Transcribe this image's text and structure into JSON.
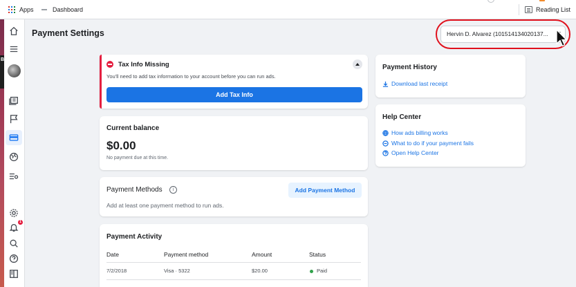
{
  "browser": {
    "bookmarks": {
      "apps": "Apps",
      "dashboard": "Dashboard",
      "reading_list": "Reading List"
    }
  },
  "strip_label": "B",
  "page": {
    "title": "Payment Settings"
  },
  "account_selector": {
    "value": "Hervin D. Alvarez (101514134020137..."
  },
  "tax_card": {
    "title": "Tax Info Missing",
    "description": "You'll need to add tax information to your account before you can run ads.",
    "button": "Add Tax Info"
  },
  "balance_card": {
    "label": "Current balance",
    "amount": "$0.00",
    "note": "No payment due at this time."
  },
  "payment_methods": {
    "title": "Payment Methods",
    "info": "i",
    "description": "Add at least one payment method to run ads.",
    "button": "Add Payment Method"
  },
  "payment_activity": {
    "title": "Payment Activity",
    "columns": [
      "Date",
      "Payment method",
      "Amount",
      "Status"
    ],
    "rows": [
      {
        "date": "7/2/2018",
        "method": "Visa · 5322",
        "amount": "$20.00",
        "status": "Paid"
      }
    ]
  },
  "payment_history": {
    "title": "Payment History",
    "links": [
      {
        "label": "Download last receipt",
        "icon": "download-icon"
      }
    ]
  },
  "help_center": {
    "title": "Help Center",
    "links": [
      {
        "label": "How ads billing works",
        "icon": "globe-icon"
      },
      {
        "label": "What to do if your payment fails",
        "icon": "minus-circle-icon"
      },
      {
        "label": "Open Help Center",
        "icon": "question-circle-icon"
      }
    ]
  },
  "sidebar": {
    "notification_count": "1",
    "items": [
      "home-icon",
      "menu-icon",
      "avatar",
      "ads-manager-icon",
      "flag-icon",
      "billing-icon",
      "globe-icon",
      "settings-list-icon",
      "gear-icon",
      "bell-icon",
      "search-icon",
      "help-icon",
      "panel-icon"
    ]
  },
  "colors": {
    "primary": "#1b74e4",
    "alert": "#e41e3f",
    "paid": "#31a24c",
    "highlight": "#e0101c"
  }
}
